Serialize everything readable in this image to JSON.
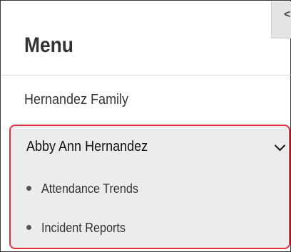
{
  "menu": {
    "title": "Menu",
    "collapse_glyph": "<",
    "family_label": "Hernandez Family",
    "selected_person": {
      "label": "Abby Ann Hernandez",
      "expanded": true,
      "sub_items": [
        {
          "label": "Attendance Trends"
        },
        {
          "label": "Incident Reports"
        }
      ]
    }
  },
  "colors": {
    "highlight_border": "#e0303f",
    "selected_background": "#ececec"
  },
  "icons": {
    "collapse": "chevron-left-icon",
    "expand": "chevron-down-icon",
    "bullet": "bullet-icon"
  }
}
